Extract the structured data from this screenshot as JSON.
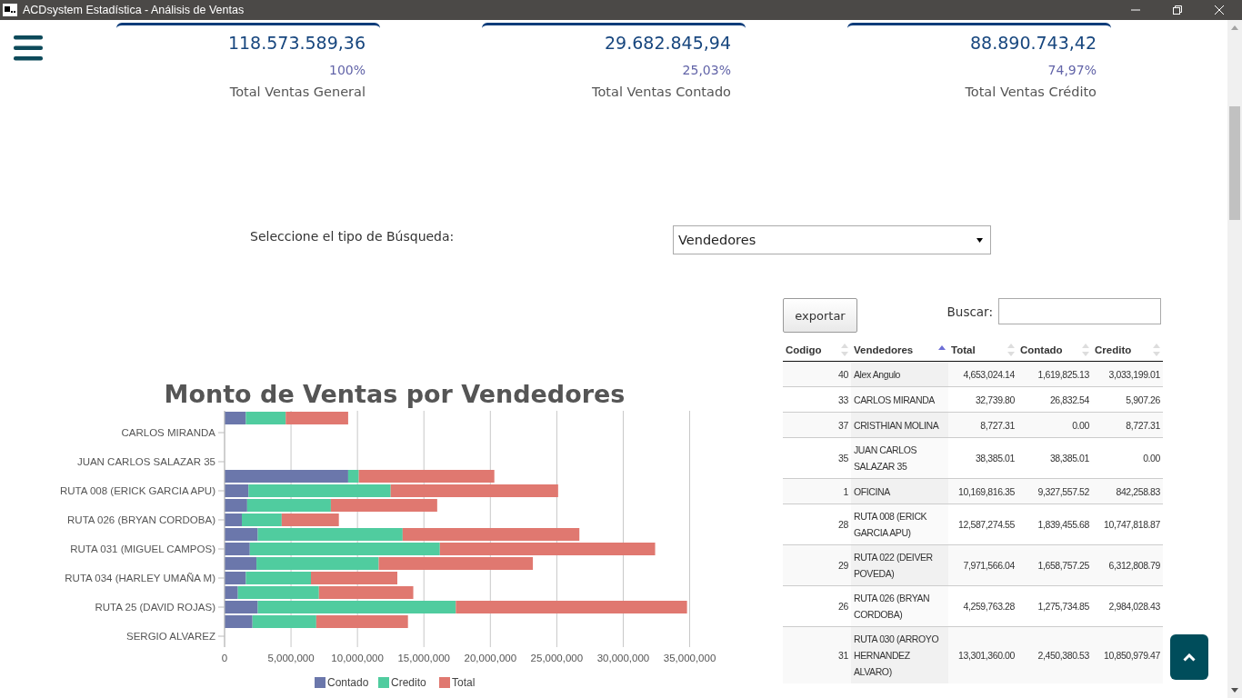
{
  "window": {
    "title": "ACDsystem Estadística - Análisis de Ventas"
  },
  "cards": [
    {
      "value": "118.573.589,36",
      "percent": "100%",
      "label": "Total Ventas General"
    },
    {
      "value": "29.682.845,94",
      "percent": "25,03%",
      "label": "Total Ventas Contado"
    },
    {
      "value": "88.890.743,42",
      "percent": "74,97%",
      "label": "Total Ventas Crédito"
    }
  ],
  "search_type": {
    "label": "Seleccione el tipo de Búsqueda:",
    "value": "Vendedores"
  },
  "chart": {
    "chart_data": {
      "type": "bar",
      "orientation": "horizontal",
      "stacked": true,
      "grid": true,
      "legend": true,
      "title": "Monto de Ventas por Vendedores",
      "categories": [
        null,
        "CARLOS MIRANDA",
        null,
        "JUAN CARLOS SALAZAR 35",
        null,
        "RUTA 008 (ERICK GARCIA APU)",
        null,
        "RUTA 026 (BRYAN CORDOBA)",
        null,
        "RUTA 031 (MIGUEL CAMPOS)",
        null,
        "RUTA 034 (HARLEY UMAÑA M)",
        null,
        "RUTA 25 (DAVID ROJAS)",
        null,
        "SERGIO ALVAREZ"
      ],
      "series": [
        {
          "name": "Contado",
          "color": "#6b77ab",
          "values": [
            1600000,
            0,
            0,
            0,
            9300000,
            1800000,
            1700000,
            1300000,
            2500000,
            1900000,
            2400000,
            1600000,
            1000000,
            2500000,
            2100000,
            0
          ]
        },
        {
          "name": "Credito",
          "color": "#50cc9f",
          "values": [
            3000000,
            0,
            0,
            0,
            800000,
            10700000,
            6300000,
            3000000,
            10900000,
            14300000,
            9200000,
            4900000,
            6100000,
            14900000,
            4800000,
            0
          ]
        },
        {
          "name": "Total",
          "color": "#e07870",
          "values": [
            4700000,
            null,
            0,
            null,
            10200000,
            12600000,
            8000000,
            4300000,
            13300000,
            16200000,
            11600000,
            6500000,
            7100000,
            17400000,
            6900000,
            0
          ]
        }
      ],
      "xlim": [
        0,
        35100000
      ],
      "xticks": [
        {
          "value": 0,
          "label": "0"
        },
        {
          "value": 5000000,
          "label": "5,000,000"
        },
        {
          "value": 10000000,
          "label": "10,000,000"
        },
        {
          "value": 15000000,
          "label": "15,000,000"
        },
        {
          "value": 20000000,
          "label": "20,000,000"
        },
        {
          "value": 25000000,
          "label": "25,000,000"
        },
        {
          "value": 30000000,
          "label": "30,000,000"
        },
        {
          "value": 35000000,
          "label": "35,000,000"
        }
      ]
    }
  },
  "export_button": "exportar",
  "search": {
    "label": "Buscar:"
  },
  "table": {
    "columns": [
      {
        "label": "Codigo",
        "sorted": false
      },
      {
        "label": "Vendedores",
        "sorted": true
      },
      {
        "label": "Total",
        "sorted": false
      },
      {
        "label": "Contado",
        "sorted": false
      },
      {
        "label": "Credito",
        "sorted": false
      }
    ],
    "rows": [
      [
        "40",
        "Alex Angulo",
        "4,653,024.14",
        "1,619,825.13",
        "3,033,199.01"
      ],
      [
        "33",
        "CARLOS MIRANDA",
        "32,739.80",
        "26,832.54",
        "5,907.26"
      ],
      [
        "37",
        "CRISTHIAN MOLINA",
        "8,727.31",
        "0.00",
        "8,727.31"
      ],
      [
        "35",
        "JUAN CARLOS SALAZAR 35",
        "38,385.01",
        "38,385.01",
        "0.00"
      ],
      [
        "1",
        "OFICINA",
        "10,169,816.35",
        "9,327,557.52",
        "842,258.83"
      ],
      [
        "28",
        "RUTA 008 (ERICK GARCIA APU)",
        "12,587,274.55",
        "1,839,455.68",
        "10,747,818.87"
      ],
      [
        "29",
        "RUTA 022 (DEIVER POVEDA)",
        "7,971,566.04",
        "1,658,757.25",
        "6,312,808.79"
      ],
      [
        "26",
        "RUTA 026 (BRYAN CORDOBA)",
        "4,259,763.28",
        "1,275,734.85",
        "2,984,028.43"
      ],
      [
        "31",
        "RUTA 030 (ARROYO HERNANDEZ ALVARO)",
        "13,301,360.00",
        "2,450,380.53",
        "10,850,979.47"
      ]
    ]
  }
}
